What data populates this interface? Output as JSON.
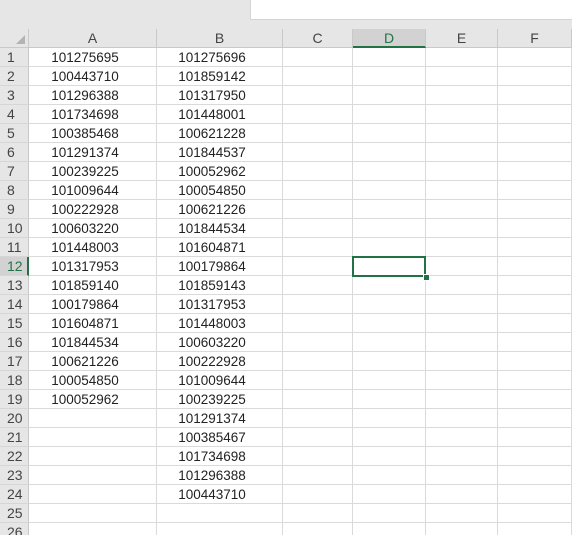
{
  "columns": [
    "A",
    "B",
    "C",
    "D",
    "E",
    "F"
  ],
  "active_column": "D",
  "active_row": "12",
  "rows": [
    "1",
    "2",
    "3",
    "4",
    "5",
    "6",
    "7",
    "8",
    "9",
    "10",
    "11",
    "12",
    "13",
    "14",
    "15",
    "16",
    "17",
    "18",
    "19",
    "20",
    "21",
    "22",
    "23",
    "24",
    "25",
    "26"
  ],
  "column_a": [
    "101275695",
    "100443710",
    "101296388",
    "101734698",
    "100385468",
    "101291374",
    "100239225",
    "101009644",
    "100222928",
    "100603220",
    "101448003",
    "101317953",
    "101859140",
    "100179864",
    "101604871",
    "101844534",
    "100621226",
    "100054850",
    "100052962"
  ],
  "column_b": [
    "101275696",
    "101859142",
    "101317950",
    "101448001",
    "100621228",
    "101844537",
    "100052962",
    "100054850",
    "100621226",
    "101844534",
    "101604871",
    "100179864",
    "101859143",
    "101317953",
    "101448003",
    "100603220",
    "100222928",
    "101009644",
    "100239225",
    "101291374",
    "100385467",
    "101734698",
    "101296388",
    "100443710"
  ],
  "selected_cell": "D12",
  "accent_color": "#217346"
}
